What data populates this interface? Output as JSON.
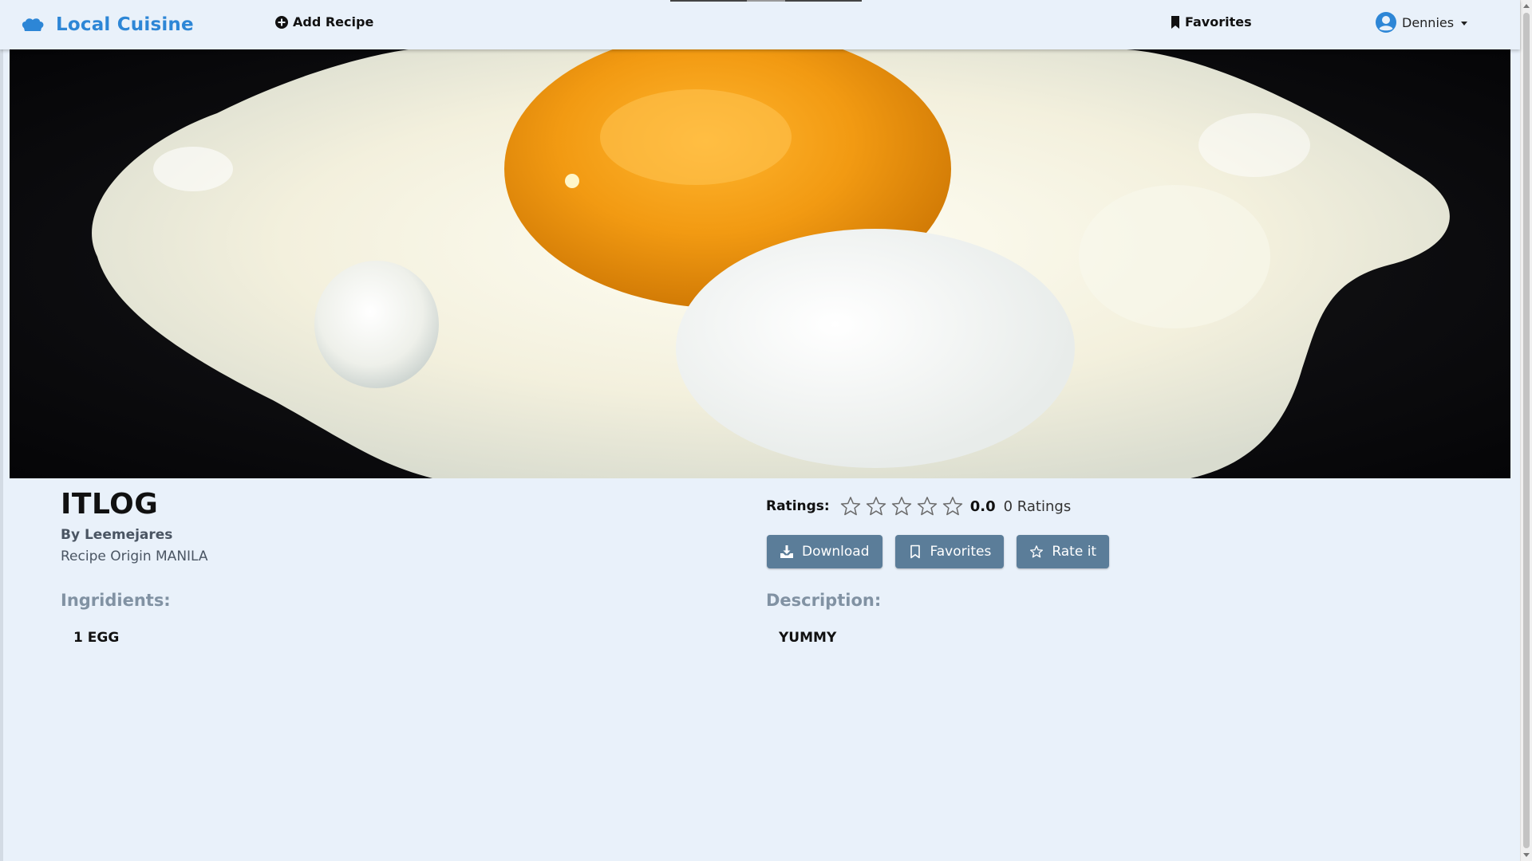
{
  "brand": {
    "name": "Local Cuisine",
    "icon": "chef-hat-icon",
    "color": "#2d86d6"
  },
  "nav": {
    "add_recipe": "Add Recipe",
    "favorites": "Favorites",
    "user": "Dennies"
  },
  "hero": {
    "image": "fried-egg-photo"
  },
  "recipe": {
    "title": "ITLOG",
    "author": "By Leemejares",
    "origin": "Recipe Origin MANILA",
    "ingredients_heading": "Ingridients:",
    "ingredients": [
      "1 EGG"
    ],
    "description_heading": "Description:",
    "description": "YUMMY"
  },
  "ratings": {
    "label": "Ratings:",
    "stars": 5,
    "filled": 0,
    "value": "0.0",
    "count_text": "0 Ratings"
  },
  "actions": {
    "download": "Download",
    "favorites": "Favorites",
    "rate": "Rate it"
  },
  "colors": {
    "background": "#e9f1fa",
    "button": "#5b7d99",
    "heading_muted": "#8192a3"
  }
}
